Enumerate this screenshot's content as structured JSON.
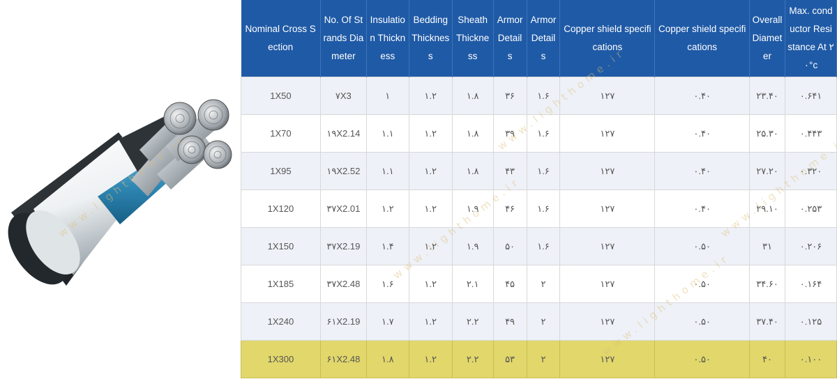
{
  "watermark": "www.lighthome.ir",
  "colors": {
    "header_bg": "#1f5aa6",
    "row_odd": "#eef1f7",
    "row_even": "#ffffff",
    "highlight": "#e1d76b"
  },
  "table": {
    "headers": [
      "Nominal Cross Section",
      "No. Of Strands Diameter",
      "Insulation Thickness",
      "Bedding Thickness",
      "Sheath Thickness",
      "Armor Details",
      "Armor Details",
      "Copper shield specifications",
      "Copper shield specifications",
      "Overall Diameter",
      "Max. conductor Resistance At ۲۰°c"
    ],
    "rows": [
      [
        "1X50",
        "۷X3",
        "۱",
        "۱.۲",
        "۱.۸",
        "۳۶",
        "۱.۶",
        "۱۲۷",
        "۰.۴۰",
        "۲۳.۴۰",
        "۰.۶۴۱"
      ],
      [
        "1X70",
        "۱۹X2.14",
        "۱.۱",
        "۱.۲",
        "۱.۸",
        "۳۹",
        "۱.۶",
        "۱۲۷",
        "۰.۴۰",
        "۲۵.۳۰",
        "۰.۴۴۳"
      ],
      [
        "1X95",
        "۱۹X2.52",
        "۱.۱",
        "۱.۲",
        "۱.۸",
        "۴۳",
        "۱.۶",
        "۱۲۷",
        "۰.۴۰",
        "۲۷.۲۰",
        "۰.۳۲۰"
      ],
      [
        "1X120",
        "۳۷X2.01",
        "۱.۲",
        "۱.۲",
        "۱.۹",
        "۴۶",
        "۱.۶",
        "۱۲۷",
        "۰.۴۰",
        "۲۹.۱۰",
        "۰.۲۵۳"
      ],
      [
        "1X150",
        "۳۷X2.19",
        "۱.۴",
        "۱.۲",
        "۱.۹",
        "۵۰",
        "۱.۶",
        "۱۲۷",
        "۰.۵۰",
        "۳۱",
        "۰.۲۰۶"
      ],
      [
        "1X185",
        "۳۷X2.48",
        "۱.۶",
        "۱.۲",
        "۲.۱",
        "۴۵",
        "۲",
        "۱۲۷",
        "۰.۵۰",
        "۳۴.۶۰",
        "۰.۱۶۴"
      ],
      [
        "1X240",
        "۶۱X2.19",
        "۱.۷",
        "۱.۲",
        "۲.۲",
        "۴۹",
        "۲",
        "۱۲۷",
        "۰.۵۰",
        "۳۷.۴۰",
        "۰.۱۲۵"
      ],
      [
        "1X300",
        "۶۱X2.48",
        "۱.۸",
        "۱.۲",
        "۲.۲",
        "۵۳",
        "۲",
        "۱۲۷",
        "۰.۵۰",
        "۴۰",
        "۰.۱۰۰"
      ]
    ]
  }
}
